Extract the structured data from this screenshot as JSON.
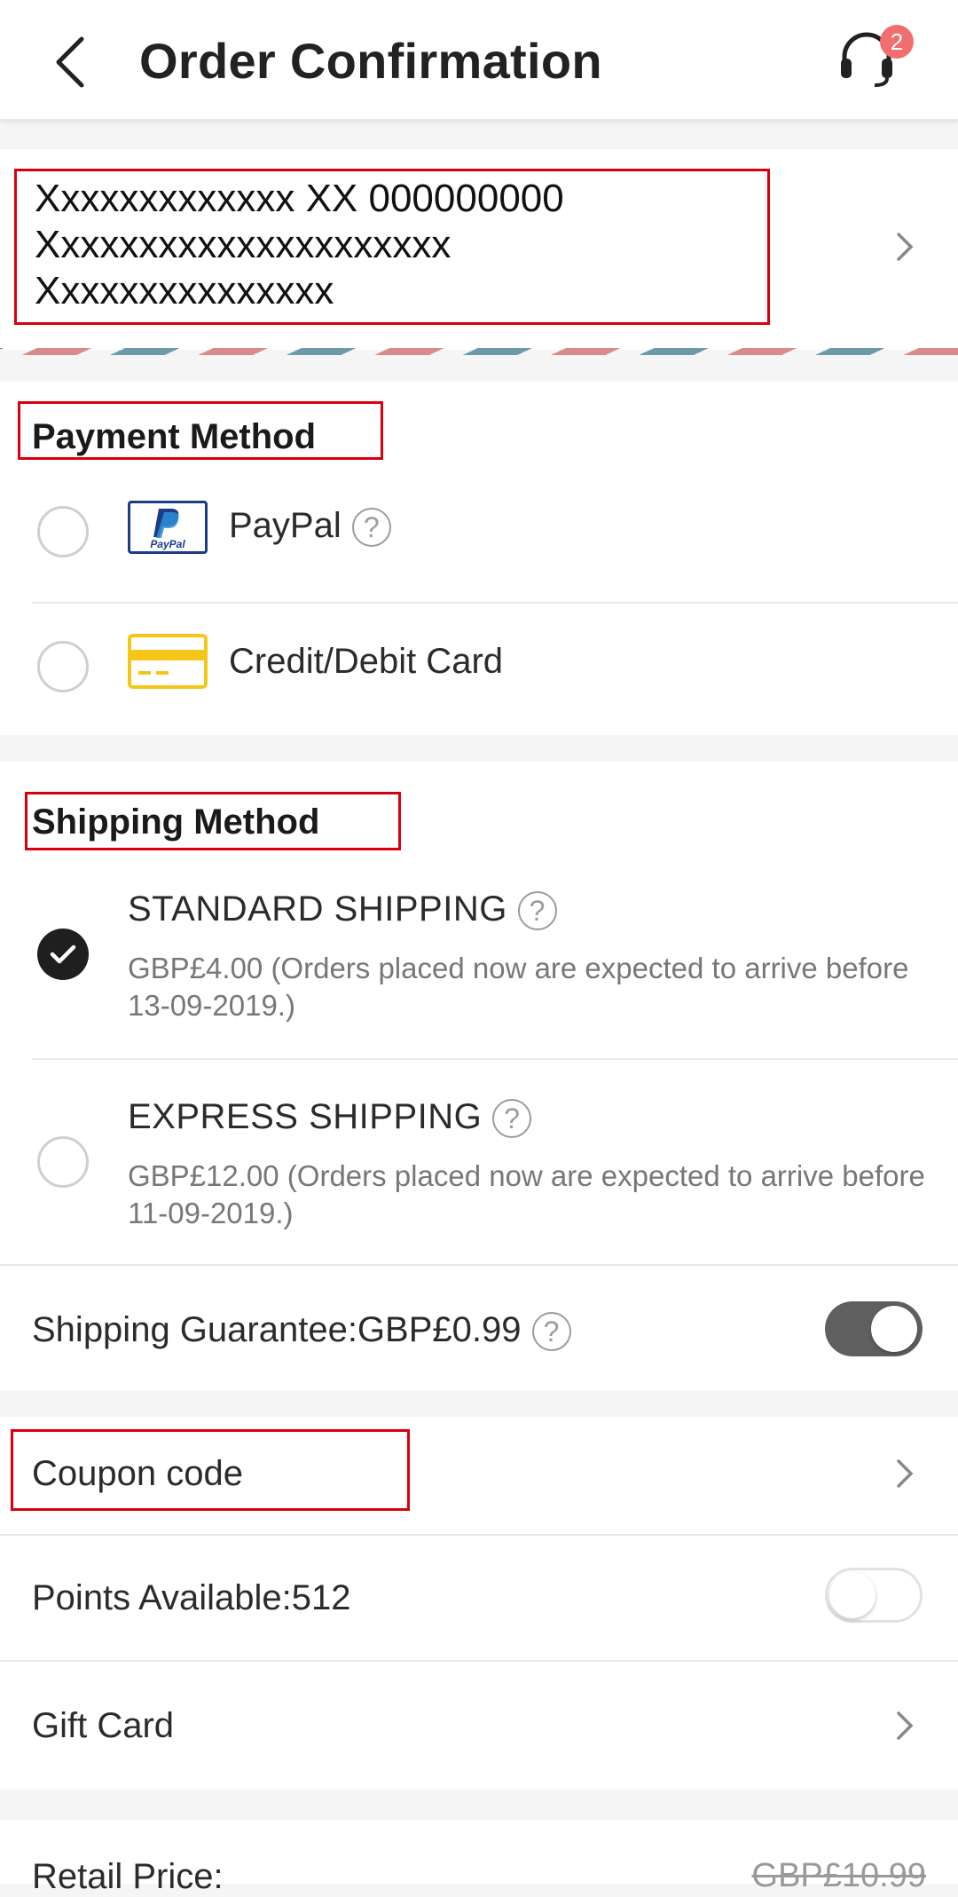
{
  "header": {
    "title": "Order Confirmation",
    "support_badge_count": "2"
  },
  "address": {
    "line1": "Xxxxxxxxxxxxx XX 000000000",
    "line2": "Xxxxxxxxxxxxxxxxxxxxx",
    "line3": "Xxxxxxxxxxxxxxx"
  },
  "payment": {
    "title": "Payment Method",
    "options": [
      {
        "label": "PayPal",
        "icon": "paypal-icon",
        "selected": false,
        "has_help": true
      },
      {
        "label": "Credit/Debit Card",
        "icon": "credit-card-icon",
        "selected": false,
        "has_help": false
      }
    ],
    "paypal_logo_text": "PayPal"
  },
  "shipping": {
    "title": "Shipping Method",
    "options": [
      {
        "name": "STANDARD SHIPPING",
        "desc": "GBP£4.00  (Orders placed now are expected to arrive before 13-09-2019.)",
        "selected": true
      },
      {
        "name": "EXPRESS SHIPPING",
        "desc": "GBP£12.00  (Orders placed now are expected to arrive before 11-09-2019.)",
        "selected": false
      }
    ],
    "guarantee_label": "Shipping Guarantee:GBP£0.99",
    "guarantee_on": true
  },
  "extras": {
    "coupon_label": "Coupon code",
    "points_label": "Points Available:512",
    "points_on": false,
    "gift_card_label": "Gift Card"
  },
  "summary": {
    "retail_label": "Retail Price:",
    "retail_value": "GBP£10.99"
  },
  "colors": {
    "highlight_box": "#d9000d",
    "badge": "#f26d6d",
    "card_icon": "#f5c518",
    "paypal_blue": "#1a3c8a"
  }
}
